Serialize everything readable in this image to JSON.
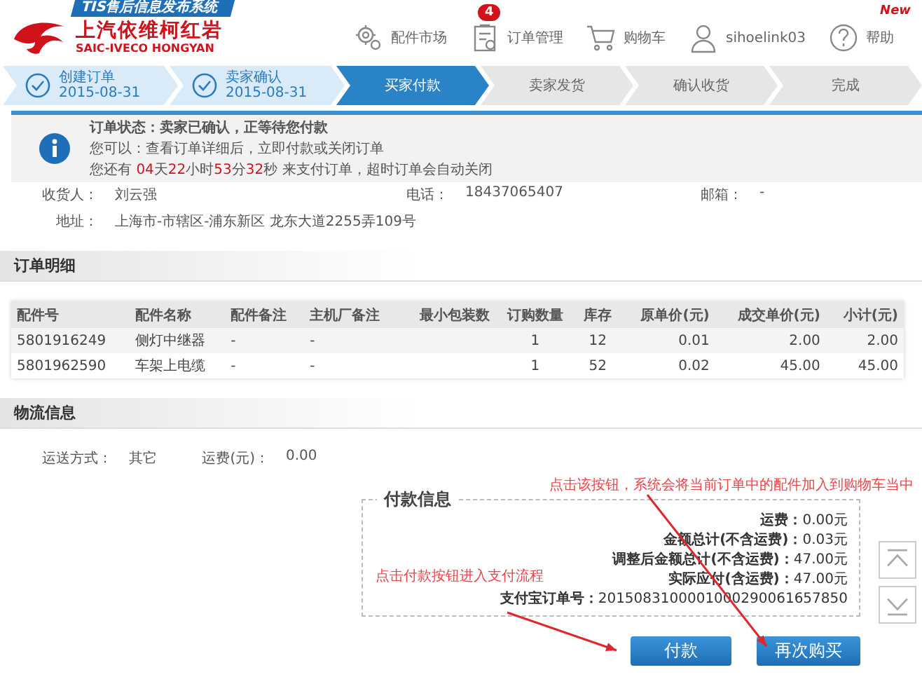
{
  "brand": {
    "tag": "TIS售后信息发布系统",
    "name": "上汽依维柯红岩",
    "name_en": "SAIC-IVECO HONGYAN"
  },
  "nav": [
    {
      "label": "配件市场"
    },
    {
      "label": "订单管理",
      "badge": "4"
    },
    {
      "label": "购物车"
    },
    {
      "label": "sihoelink03"
    },
    {
      "label": "帮助",
      "flag": "New"
    }
  ],
  "steps": [
    {
      "label": "创建订单",
      "date": "2015-08-31",
      "completed": true,
      "selected": false
    },
    {
      "label": "卖家确认",
      "date": "2015-08-31",
      "completed": true,
      "selected": false
    },
    {
      "label": "买家付款",
      "completed": false,
      "selected": true
    },
    {
      "label": "卖家发货",
      "completed": false,
      "selected": false
    },
    {
      "label": "确认收货",
      "completed": false,
      "selected": false
    },
    {
      "label": "完成",
      "completed": false,
      "selected": false
    }
  ],
  "status": {
    "title": "订单状态：卖家已确认，正等待您付款",
    "hint": "您可以：查看订单详细后，立即付款或关闭订单",
    "countdown": [
      {
        "text": "您还有 ",
        "highlight": false
      },
      {
        "text": "04",
        "highlight": true
      },
      {
        "text": "天",
        "highlight": false
      },
      {
        "text": "22",
        "highlight": true
      },
      {
        "text": "小时",
        "highlight": false
      },
      {
        "text": "53",
        "highlight": true
      },
      {
        "text": "分",
        "highlight": false
      },
      {
        "text": "32",
        "highlight": true
      },
      {
        "text": "秒 来支付订单，超时订单会自动关闭",
        "highlight": false
      }
    ]
  },
  "receiver": [
    {
      "label": "收货人：",
      "value": "刘云强"
    },
    {
      "label": "电话：",
      "value": "18437065407"
    },
    {
      "label": "邮箱：",
      "value": "-"
    }
  ],
  "address": {
    "label": "地址：",
    "value": "上海市-市辖区-浦东新区 龙东大道2255弄109号"
  },
  "order_section": {
    "title": "订单明细"
  },
  "table": {
    "columns": [
      "配件号",
      "配件名称",
      "配件备注",
      "主机厂备注",
      "最小包装数",
      "订购数量",
      "库存",
      "原单价(元)",
      "成交单价(元)",
      "小计(元)"
    ],
    "rows": [
      [
        "5801916249",
        "侧灯中继器",
        "-",
        "-",
        "",
        "1",
        "12",
        "0.01",
        "2.00",
        "2.00"
      ],
      [
        "5801962590",
        "车架上电缆",
        "-",
        "-",
        "",
        "1",
        "52",
        "0.02",
        "45.00",
        "45.00"
      ]
    ]
  },
  "logistics_section": {
    "title": "物流信息"
  },
  "logistics": [
    {
      "label": "运送方式：",
      "value": "其它"
    },
    {
      "label": "运费(元)：",
      "value": "0.00"
    }
  ],
  "payment": {
    "title": "付款信息",
    "lines": [
      {
        "label": "运费：",
        "value": "0.00元"
      },
      {
        "label": "金额总计(不含运费)：",
        "value": "0.03元"
      },
      {
        "label": "调整后金额总计(不含运费)：",
        "value": "47.00元"
      },
      {
        "label": "实际应付(含运费)：",
        "value": "47.00元"
      },
      {
        "label": "支付宝订单号：",
        "value": "2015083100001000290061657850"
      }
    ]
  },
  "buttons": [
    {
      "label": "付款"
    },
    {
      "label": "再次购买"
    }
  ],
  "annotations": [
    {
      "text": "点击该按钮，系统会将当前订单中的配件加入到购物车当中"
    },
    {
      "text": "点击付款按钮进入支付流程"
    }
  ]
}
